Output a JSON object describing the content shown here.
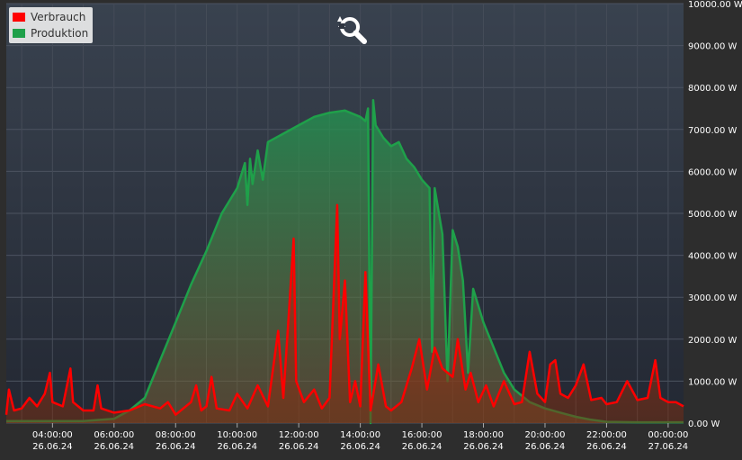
{
  "chart_data": {
    "type": "area",
    "legend_position": "top-left",
    "grid": true,
    "ylim": [
      0,
      10000
    ],
    "xlim": [
      "2024-06-26 02:30",
      "2024-06-27 00:30"
    ],
    "y_ticks": [
      {
        "value": 0,
        "label": "0.00 W"
      },
      {
        "value": 1000,
        "label": "1000.00 W"
      },
      {
        "value": 2000,
        "label": "2000.00 W"
      },
      {
        "value": 3000,
        "label": "3000.00 W"
      },
      {
        "value": 4000,
        "label": "4000.00 W"
      },
      {
        "value": 5000,
        "label": "5000.00 W"
      },
      {
        "value": 6000,
        "label": "6000.00 W"
      },
      {
        "value": 7000,
        "label": "7000.00 W"
      },
      {
        "value": 8000,
        "label": "8000.00 W"
      },
      {
        "value": 9000,
        "label": "9000.00 W"
      },
      {
        "value": 10000,
        "label": "10000.00 W"
      }
    ],
    "x_ticks": [
      {
        "value": "2024-06-26 04:00",
        "time": "04:00:00",
        "date": "26.06.24"
      },
      {
        "value": "2024-06-26 06:00",
        "time": "06:00:00",
        "date": "26.06.24"
      },
      {
        "value": "2024-06-26 08:00",
        "time": "08:00:00",
        "date": "26.06.24"
      },
      {
        "value": "2024-06-26 10:00",
        "time": "10:00:00",
        "date": "26.06.24"
      },
      {
        "value": "2024-06-26 12:00",
        "time": "12:00:00",
        "date": "26.06.24"
      },
      {
        "value": "2024-06-26 14:00",
        "time": "14:00:00",
        "date": "26.06.24"
      },
      {
        "value": "2024-06-26 16:00",
        "time": "16:00:00",
        "date": "26.06.24"
      },
      {
        "value": "2024-06-26 18:00",
        "time": "18:00:00",
        "date": "26.06.24"
      },
      {
        "value": "2024-06-26 20:00",
        "time": "20:00:00",
        "date": "26.06.24"
      },
      {
        "value": "2024-06-26 22:00",
        "time": "22:00:00",
        "date": "26.06.24"
      },
      {
        "value": "2024-06-27 00:00",
        "time": "00:00:00",
        "date": "27.06.24"
      }
    ],
    "series": [
      {
        "name": "Verbrauch",
        "color": "#ff0000",
        "points": [
          [
            "2024-06-26 02:30",
            200
          ],
          [
            "2024-06-26 02:35",
            800
          ],
          [
            "2024-06-26 02:45",
            300
          ],
          [
            "2024-06-26 03:00",
            350
          ],
          [
            "2024-06-26 03:15",
            600
          ],
          [
            "2024-06-26 03:30",
            400
          ],
          [
            "2024-06-26 03:45",
            700
          ],
          [
            "2024-06-26 03:55",
            1200
          ],
          [
            "2024-06-26 04:00",
            500
          ],
          [
            "2024-06-26 04:20",
            400
          ],
          [
            "2024-06-26 04:35",
            1300
          ],
          [
            "2024-06-26 04:40",
            500
          ],
          [
            "2024-06-26 05:00",
            300
          ],
          [
            "2024-06-26 05:20",
            300
          ],
          [
            "2024-06-26 05:28",
            900
          ],
          [
            "2024-06-26 05:35",
            350
          ],
          [
            "2024-06-26 06:00",
            250
          ],
          [
            "2024-06-26 06:30",
            300
          ],
          [
            "2024-06-26 07:00",
            450
          ],
          [
            "2024-06-26 07:30",
            350
          ],
          [
            "2024-06-26 07:45",
            500
          ],
          [
            "2024-06-26 08:00",
            200
          ],
          [
            "2024-06-26 08:30",
            500
          ],
          [
            "2024-06-26 08:40",
            900
          ],
          [
            "2024-06-26 08:50",
            300
          ],
          [
            "2024-06-26 09:00",
            400
          ],
          [
            "2024-06-26 09:10",
            1100
          ],
          [
            "2024-06-26 09:20",
            350
          ],
          [
            "2024-06-26 09:45",
            300
          ],
          [
            "2024-06-26 10:00",
            700
          ],
          [
            "2024-06-26 10:20",
            350
          ],
          [
            "2024-06-26 10:40",
            900
          ],
          [
            "2024-06-26 11:00",
            400
          ],
          [
            "2024-06-26 11:20",
            2200
          ],
          [
            "2024-06-26 11:30",
            600
          ],
          [
            "2024-06-26 11:40",
            2500
          ],
          [
            "2024-06-26 11:50",
            4400
          ],
          [
            "2024-06-26 11:55",
            1000
          ],
          [
            "2024-06-26 12:10",
            500
          ],
          [
            "2024-06-26 12:30",
            800
          ],
          [
            "2024-06-26 12:45",
            350
          ],
          [
            "2024-06-26 13:00",
            600
          ],
          [
            "2024-06-26 13:15",
            5200
          ],
          [
            "2024-06-26 13:20",
            2000
          ],
          [
            "2024-06-26 13:30",
            3400
          ],
          [
            "2024-06-26 13:40",
            500
          ],
          [
            "2024-06-26 13:50",
            1000
          ],
          [
            "2024-06-26 14:00",
            400
          ],
          [
            "2024-06-26 14:10",
            3600
          ],
          [
            "2024-06-26 14:20",
            300
          ],
          [
            "2024-06-26 14:35",
            1400
          ],
          [
            "2024-06-26 14:50",
            400
          ],
          [
            "2024-06-26 15:00",
            300
          ],
          [
            "2024-06-26 15:20",
            500
          ],
          [
            "2024-06-26 15:40",
            1300
          ],
          [
            "2024-06-26 15:55",
            2000
          ],
          [
            "2024-06-26 16:10",
            800
          ],
          [
            "2024-06-26 16:25",
            1800
          ],
          [
            "2024-06-26 16:40",
            1300
          ],
          [
            "2024-06-26 17:00",
            1100
          ],
          [
            "2024-06-26 17:10",
            2000
          ],
          [
            "2024-06-26 17:25",
            800
          ],
          [
            "2024-06-26 17:35",
            1200
          ],
          [
            "2024-06-26 17:50",
            500
          ],
          [
            "2024-06-26 18:05",
            900
          ],
          [
            "2024-06-26 18:20",
            400
          ],
          [
            "2024-06-26 18:40",
            1000
          ],
          [
            "2024-06-26 19:00",
            450
          ],
          [
            "2024-06-26 19:15",
            500
          ],
          [
            "2024-06-26 19:30",
            1700
          ],
          [
            "2024-06-26 19:45",
            700
          ],
          [
            "2024-06-26 20:00",
            500
          ],
          [
            "2024-06-26 20:10",
            1400
          ],
          [
            "2024-06-26 20:20",
            1500
          ],
          [
            "2024-06-26 20:30",
            700
          ],
          [
            "2024-06-26 20:45",
            600
          ],
          [
            "2024-06-26 21:00",
            900
          ],
          [
            "2024-06-26 21:15",
            1400
          ],
          [
            "2024-06-26 21:30",
            550
          ],
          [
            "2024-06-26 21:50",
            600
          ],
          [
            "2024-06-26 22:00",
            450
          ],
          [
            "2024-06-26 22:20",
            500
          ],
          [
            "2024-06-26 22:40",
            1000
          ],
          [
            "2024-06-26 23:00",
            550
          ],
          [
            "2024-06-26 23:20",
            600
          ],
          [
            "2024-06-26 23:35",
            1500
          ],
          [
            "2024-06-26 23:45",
            600
          ],
          [
            "2024-06-27 00:00",
            500
          ],
          [
            "2024-06-27 00:15",
            500
          ],
          [
            "2024-06-27 00:30",
            400
          ]
        ]
      },
      {
        "name": "Produktion",
        "color": "#1fa04a",
        "points": [
          [
            "2024-06-26 02:30",
            50
          ],
          [
            "2024-06-26 03:30",
            50
          ],
          [
            "2024-06-26 05:00",
            50
          ],
          [
            "2024-06-26 06:00",
            100
          ],
          [
            "2024-06-26 06:30",
            300
          ],
          [
            "2024-06-26 07:00",
            600
          ],
          [
            "2024-06-26 07:30",
            1500
          ],
          [
            "2024-06-26 08:00",
            2400
          ],
          [
            "2024-06-26 08:30",
            3300
          ],
          [
            "2024-06-26 09:00",
            4100
          ],
          [
            "2024-06-26 09:30",
            5000
          ],
          [
            "2024-06-26 10:00",
            5600
          ],
          [
            "2024-06-26 10:15",
            6200
          ],
          [
            "2024-06-26 10:20",
            5200
          ],
          [
            "2024-06-26 10:25",
            6300
          ],
          [
            "2024-06-26 10:30",
            5700
          ],
          [
            "2024-06-26 10:40",
            6500
          ],
          [
            "2024-06-26 10:50",
            5800
          ],
          [
            "2024-06-26 11:00",
            6700
          ],
          [
            "2024-06-26 11:30",
            6900
          ],
          [
            "2024-06-26 12:00",
            7100
          ],
          [
            "2024-06-26 12:30",
            7300
          ],
          [
            "2024-06-26 13:00",
            7400
          ],
          [
            "2024-06-26 13:30",
            7450
          ],
          [
            "2024-06-26 14:00",
            7300
          ],
          [
            "2024-06-26 14:10",
            7200
          ],
          [
            "2024-06-26 14:15",
            7500
          ],
          [
            "2024-06-26 14:20",
            0
          ],
          [
            "2024-06-26 14:25",
            7700
          ],
          [
            "2024-06-26 14:30",
            7100
          ],
          [
            "2024-06-26 14:45",
            6800
          ],
          [
            "2024-06-26 15:00",
            6600
          ],
          [
            "2024-06-26 15:15",
            6700
          ],
          [
            "2024-06-26 15:30",
            6300
          ],
          [
            "2024-06-26 15:45",
            6100
          ],
          [
            "2024-06-26 16:00",
            5800
          ],
          [
            "2024-06-26 16:15",
            5600
          ],
          [
            "2024-06-26 16:20",
            1700
          ],
          [
            "2024-06-26 16:25",
            5600
          ],
          [
            "2024-06-26 16:40",
            4500
          ],
          [
            "2024-06-26 16:50",
            1000
          ],
          [
            "2024-06-26 17:00",
            4600
          ],
          [
            "2024-06-26 17:10",
            4200
          ],
          [
            "2024-06-26 17:20",
            3400
          ],
          [
            "2024-06-26 17:30",
            1200
          ],
          [
            "2024-06-26 17:40",
            3200
          ],
          [
            "2024-06-26 18:00",
            2400
          ],
          [
            "2024-06-26 18:20",
            1800
          ],
          [
            "2024-06-26 18:40",
            1200
          ],
          [
            "2024-06-26 19:00",
            800
          ],
          [
            "2024-06-26 19:30",
            500
          ],
          [
            "2024-06-26 20:00",
            350
          ],
          [
            "2024-06-26 20:30",
            250
          ],
          [
            "2024-06-26 21:00",
            150
          ],
          [
            "2024-06-26 21:30",
            80
          ],
          [
            "2024-06-26 22:00",
            30
          ],
          [
            "2024-06-26 23:00",
            20
          ],
          [
            "2024-06-27 00:00",
            20
          ],
          [
            "2024-06-27 00:30",
            20
          ]
        ]
      }
    ]
  },
  "legend": {
    "items": [
      {
        "label": "Verbrauch",
        "color": "#ff0000"
      },
      {
        "label": "Produktion",
        "color": "#1fa04a"
      }
    ]
  },
  "zoom_icon": "zoom-reset-icon"
}
